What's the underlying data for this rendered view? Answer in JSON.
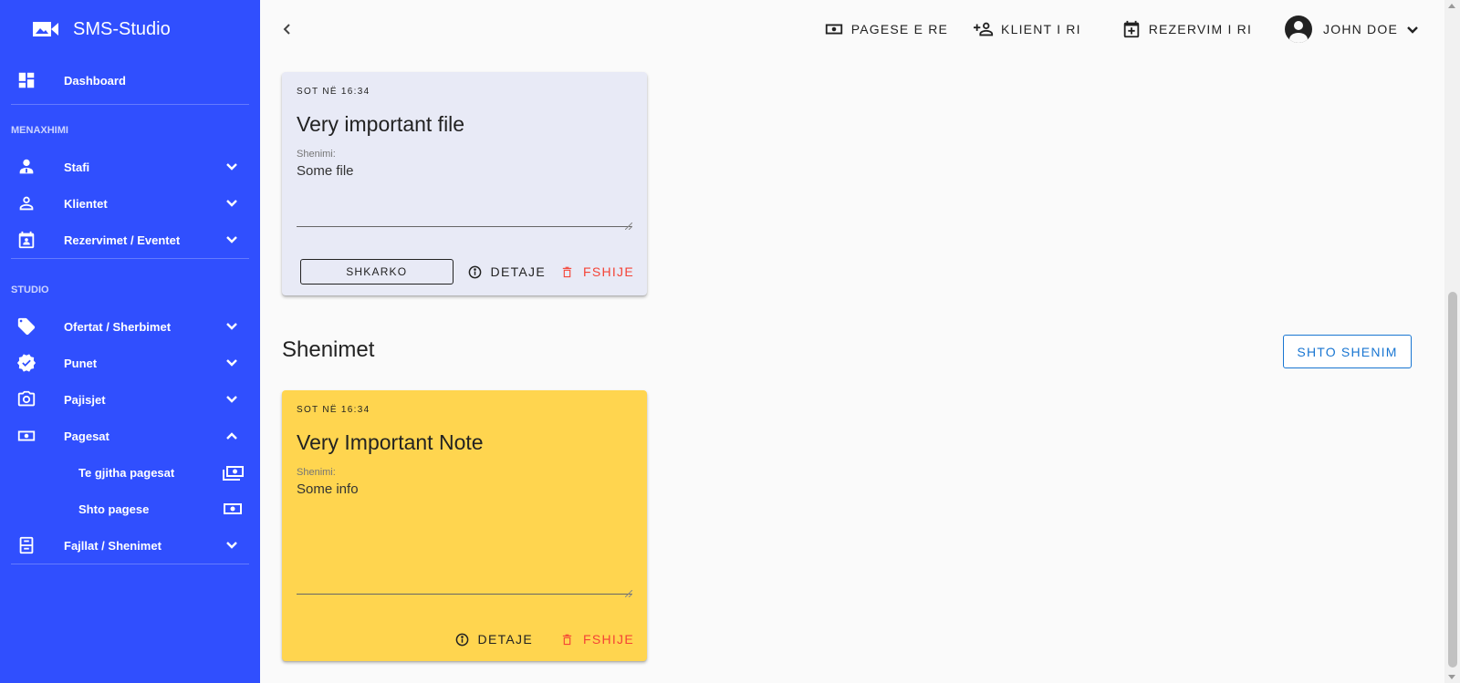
{
  "app": {
    "title": "SMS-Studio"
  },
  "colors": {
    "sidebar": "#304ffe",
    "file_card": "#e8eaf6",
    "note_card": "#ffd54f",
    "danger": "#f44336",
    "primary": "#1976d2"
  },
  "sidebar": {
    "dashboard": "Dashboard",
    "section_management": "MENAXHIMI",
    "staff": "Stafi",
    "clients": "Klientet",
    "reservations": "Rezervimet / Eventet",
    "section_studio": "STUDIO",
    "offers": "Ofertat / Sherbimet",
    "jobs": "Punet",
    "devices": "Pajisjet",
    "payments": "Pagesat",
    "all_payments": "Te gjitha pagesat",
    "add_payment": "Shto pagese",
    "files": "Fajllat / Shenimet"
  },
  "topbar": {
    "new_payment": "PAGESE E RE",
    "new_client": "KLIENT I RI",
    "new_reservation": "REZERVIM I RI",
    "user_name": "JOHN DOE"
  },
  "file_card": {
    "time": "SOT NË 16:34",
    "title": "Very important file",
    "field_label": "Shenimi:",
    "field_value": "Some file",
    "download": "SHKARKO",
    "details": "DETAJE",
    "delete": "FSHIJE"
  },
  "notes_section": {
    "heading": "Shenimet",
    "add_note": "SHTO SHENIM"
  },
  "note_card": {
    "time": "SOT NË 16:34",
    "title": "Very Important Note",
    "field_label": "Shenimi:",
    "field_value": "Some info",
    "details": "DETAJE",
    "delete": "FSHIJE"
  }
}
